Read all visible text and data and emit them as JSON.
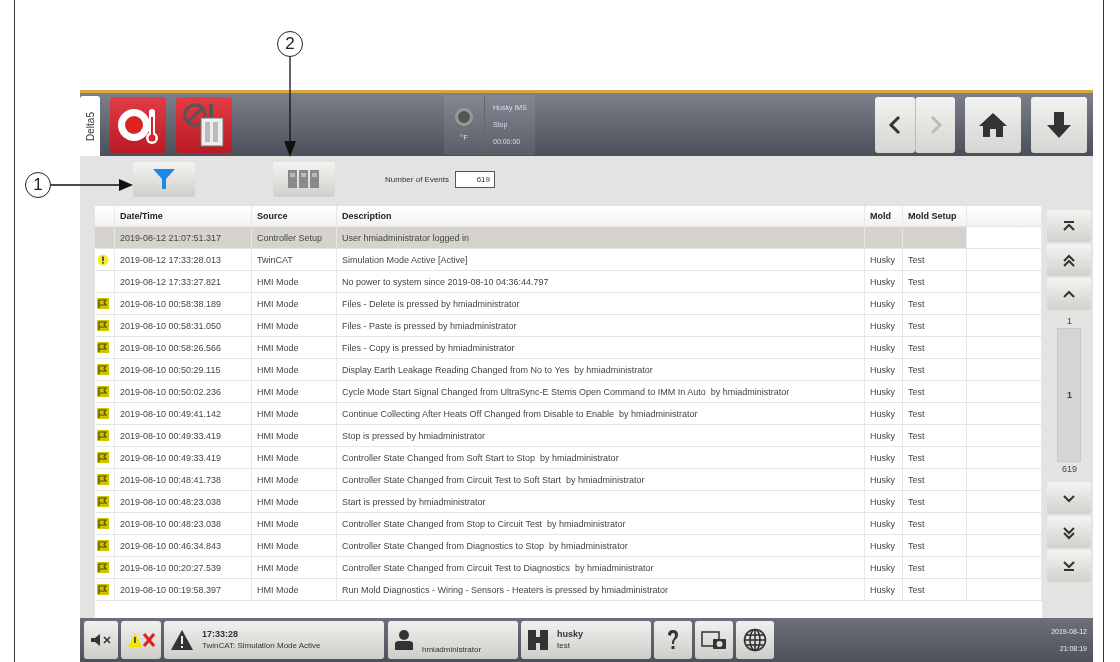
{
  "callouts": [
    {
      "number": "1"
    },
    {
      "number": "2"
    }
  ],
  "top_bar": {
    "tab": "Delta5",
    "status": {
      "unit": "°F",
      "machine": "Husky IMS",
      "state": "Stop",
      "time": "00:00:00"
    },
    "nav": {
      "back_disabled": false,
      "forward_disabled": true
    }
  },
  "toolbar": {
    "events_label": "Number of Events",
    "events_value": "619"
  },
  "table": {
    "columns": [
      "Date/Time",
      "Source",
      "Description",
      "Mold",
      "Mold Setup"
    ],
    "rows": [
      {
        "kind": "plain",
        "selected": true,
        "cells": [
          "2019-08-12 21:07:51.317",
          "Controller Setup",
          "User hmiadministrator logged in",
          "",
          ""
        ]
      },
      {
        "kind": "warning",
        "selected": false,
        "cells": [
          "2019-08-12 17:33:28.013",
          "TwinCAT",
          "Simulation Mode Active [Active]",
          "Husky",
          "Test"
        ]
      },
      {
        "kind": "plain",
        "selected": false,
        "cells": [
          "2019-08-12 17:33:27.821",
          "HMI Mode",
          "No power to system since 2019-08-10 04:36:44.797",
          "Husky",
          "Test"
        ]
      },
      {
        "kind": "flag",
        "selected": false,
        "cells": [
          "2019-08-10 00:58:38.189",
          "HMI Mode",
          "Files - Delete is pressed by hmiadministrator",
          "Husky",
          "Test"
        ]
      },
      {
        "kind": "flag",
        "selected": false,
        "cells": [
          "2019-08-10 00:58:31.050",
          "HMI Mode",
          "Files - Paste is pressed by hmiadministrator",
          "Husky",
          "Test"
        ]
      },
      {
        "kind": "flag",
        "selected": false,
        "cells": [
          "2019-08-10 00:58:26.566",
          "HMI Mode",
          "Files - Copy is pressed by hmiadministrator",
          "Husky",
          "Test"
        ]
      },
      {
        "kind": "flag",
        "selected": false,
        "cells": [
          "2019-08-10 00:50:29.115",
          "HMI Mode",
          "Display Earth Leakage Reading Changed from No to Yes  by hmiadministrator",
          "Husky",
          "Test"
        ]
      },
      {
        "kind": "flag",
        "selected": false,
        "cells": [
          "2019-08-10 00:50:02.236",
          "HMI Mode",
          "Cycle Mode Start Signal Changed from UltraSync-E Stems Open Command to IMM In Auto  by hmiadministrator",
          "Husky",
          "Test"
        ]
      },
      {
        "kind": "flag",
        "selected": false,
        "cells": [
          "2019-08-10 00:49:41.142",
          "HMI Mode",
          "Continue Collecting After Heats Off Changed from Disable to Enable  by hmiadministrator",
          "Husky",
          "Test"
        ]
      },
      {
        "kind": "flag",
        "selected": false,
        "cells": [
          "2019-08-10 00:49:33.419",
          "HMI Mode",
          "Stop is pressed by hmiadministrator",
          "Husky",
          "Test"
        ]
      },
      {
        "kind": "flag",
        "selected": false,
        "cells": [
          "2019-08-10 00:49:33.419",
          "HMI Mode",
          "Controller State Changed from Soft Start to Stop  by hmiadministrator",
          "Husky",
          "Test"
        ]
      },
      {
        "kind": "flag",
        "selected": false,
        "cells": [
          "2019-08-10 00:48:41.738",
          "HMI Mode",
          "Controller State Changed from Circuit Test to Soft Start  by hmiadministrator",
          "Husky",
          "Test"
        ]
      },
      {
        "kind": "flag",
        "selected": false,
        "cells": [
          "2019-08-10 00:48:23.038",
          "HMI Mode",
          "Start is pressed by hmiadministrator",
          "Husky",
          "Test"
        ]
      },
      {
        "kind": "flag",
        "selected": false,
        "cells": [
          "2019-08-10 00:48:23.038",
          "HMI Mode",
          "Controller State Changed from Stop to Circuit Test  by hmiadministrator",
          "Husky",
          "Test"
        ]
      },
      {
        "kind": "flag",
        "selected": false,
        "cells": [
          "2019-08-10 00:46:34.843",
          "HMI Mode",
          "Controller State Changed from Diagnostics to Stop  by hmiadministrator",
          "Husky",
          "Test"
        ]
      },
      {
        "kind": "flag",
        "selected": false,
        "cells": [
          "2019-08-10 00:20:27.539",
          "HMI Mode",
          "Controller State Changed from Circuit Test to Diagnostics  by hmiadministrator",
          "Husky",
          "Test"
        ]
      },
      {
        "kind": "flag",
        "selected": false,
        "cells": [
          "2019-08-10 00:19:58.397",
          "HMI Mode",
          "Run Mold Diagnostics - Wiring - Sensors - Heaters is pressed by hmiadministrator",
          "Husky",
          "Test"
        ]
      }
    ]
  },
  "scroll_panel": {
    "first": "1",
    "current": "1",
    "last": "619"
  },
  "status_bar": {
    "alarm_time": "17:33:28",
    "alarm_message": "TwinCAT: Simulation Mode Active",
    "user": "hmiadministrator",
    "mold": "husky",
    "mold_setup": "test",
    "date": "2019-08-12",
    "time": "21:08:19"
  }
}
